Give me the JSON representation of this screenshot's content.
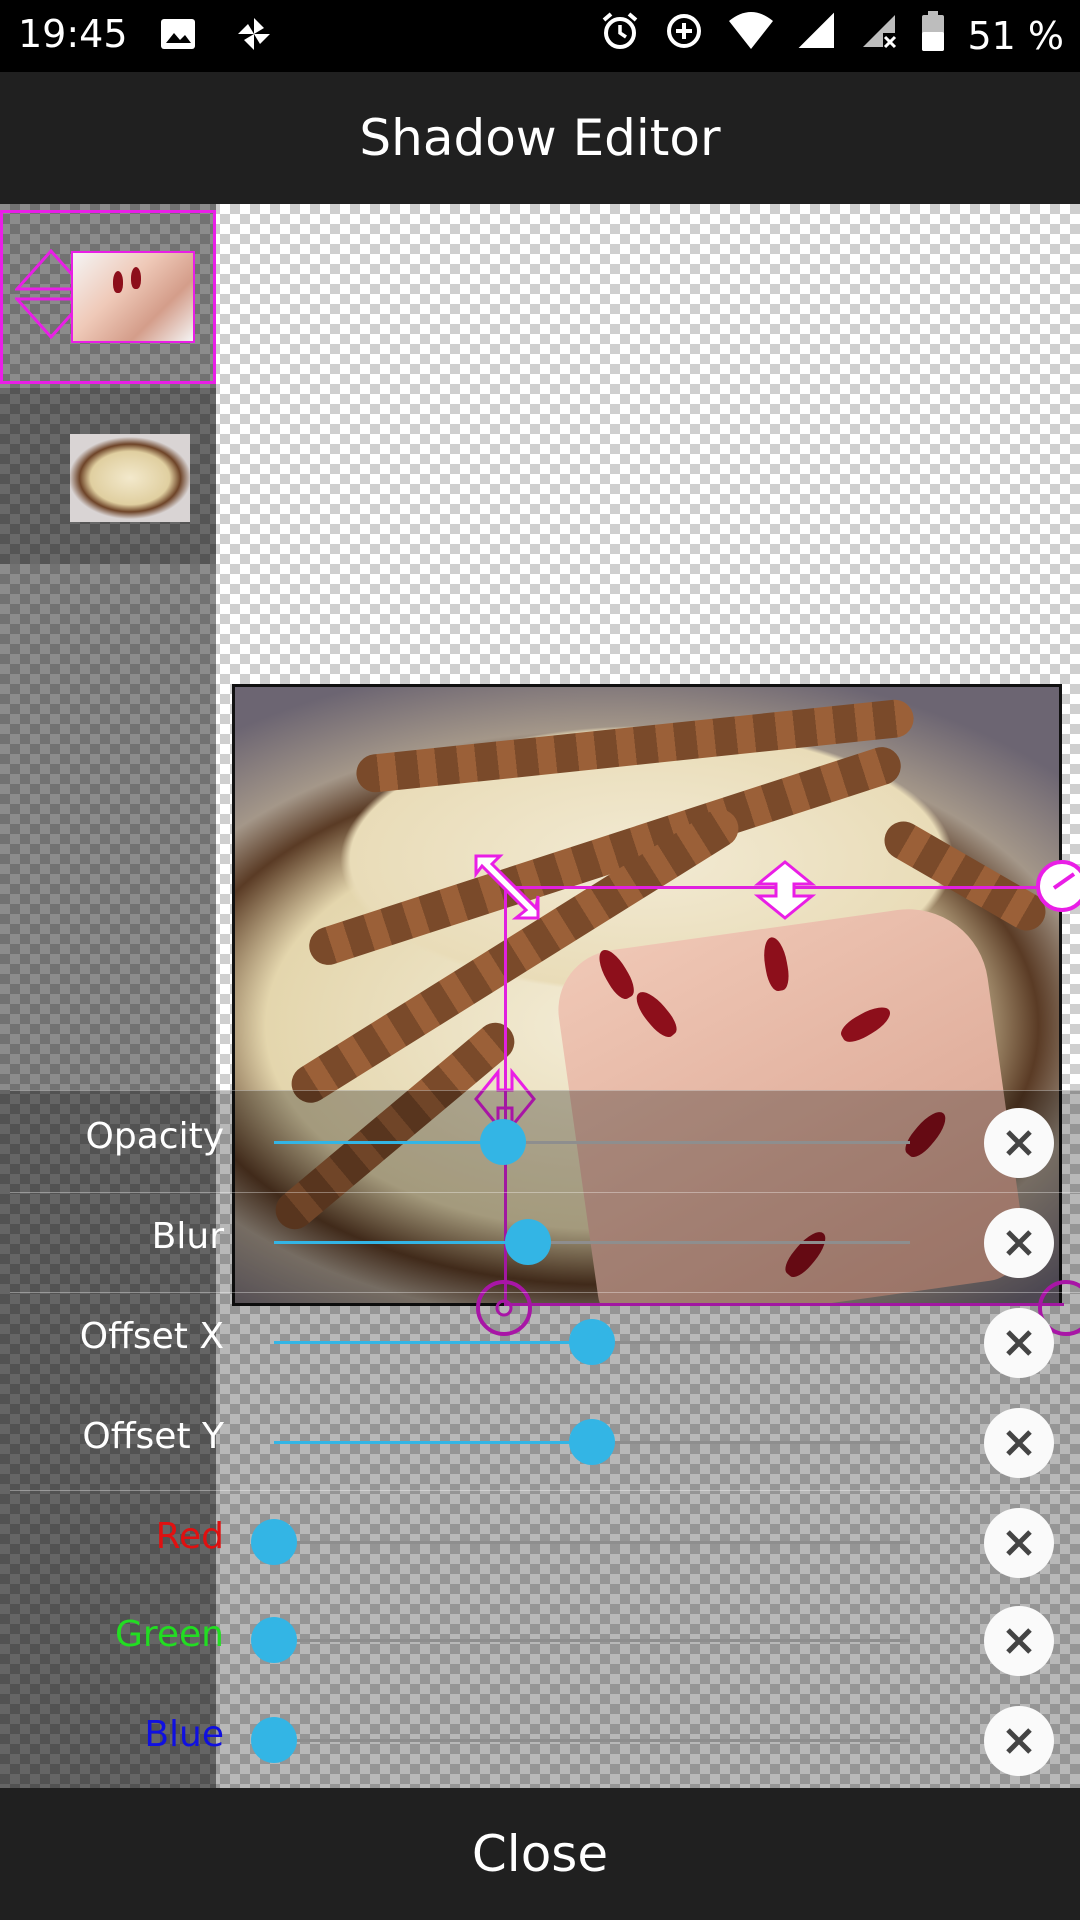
{
  "status_bar": {
    "time": "19:45",
    "battery": "51 %",
    "left_icons": [
      "image-icon",
      "pinwheel-icon"
    ],
    "right_icons": [
      "alarm-icon",
      "data-saver-icon",
      "wifi-icon",
      "signal-icon",
      "signal-no-data-icon",
      "battery-icon"
    ]
  },
  "app_bar": {
    "title": "Shadow Editor"
  },
  "layers": [
    {
      "name": "hand-layer",
      "selected": true
    },
    {
      "name": "cake-layer",
      "selected": false
    }
  ],
  "sliders": [
    {
      "label": "Opacity",
      "value": 0.36,
      "label_color": "#ffffff"
    },
    {
      "label": "Blur",
      "value": 0.4,
      "label_color": "#ffffff"
    },
    {
      "label": "Offset X",
      "value": 0.5,
      "label_color": "#ffffff"
    },
    {
      "label": "Offset Y",
      "value": 0.5,
      "label_color": "#ffffff"
    },
    {
      "label": "Red",
      "value": 0.0,
      "label_color": "#e01010"
    },
    {
      "label": "Green",
      "value": 0.0,
      "label_color": "#22dd22"
    },
    {
      "label": "Blue",
      "value": 0.0,
      "label_color": "#1010e0"
    }
  ],
  "colors": {
    "accent": "#33b5e5",
    "selection": "#e91ee6"
  },
  "footer": {
    "close_label": "Close"
  }
}
